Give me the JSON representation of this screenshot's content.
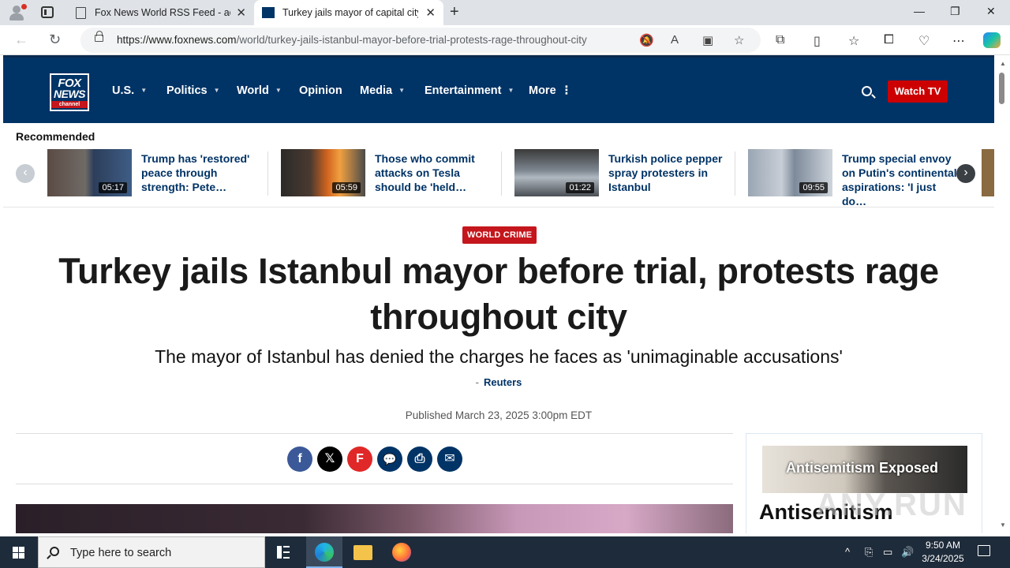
{
  "browser": {
    "tabs": [
      {
        "title": "Fox News World RSS Feed - aero",
        "active": false
      },
      {
        "title": "Turkey jails mayor of capital city",
        "active": true
      }
    ],
    "url_domain": "https://www.foxnews.com",
    "url_path": "/world/turkey-jails-istanbul-mayor-before-trial-protests-rage-throughout-city",
    "window_controls": [
      "—",
      "❐",
      "✕"
    ]
  },
  "site": {
    "logo": {
      "line1": "FOX",
      "line2": "NEWS",
      "line3": "channel"
    },
    "nav": [
      {
        "label": "U.S.",
        "caret": true
      },
      {
        "label": "Politics",
        "caret": true
      },
      {
        "label": "World",
        "caret": true
      },
      {
        "label": "Opinion",
        "caret": false
      },
      {
        "label": "Media",
        "caret": true
      },
      {
        "label": "Entertainment",
        "caret": true
      },
      {
        "label": "More",
        "caret": false
      }
    ],
    "watch_tv": "Watch TV",
    "colors": {
      "brand_navy": "#003366",
      "brand_red": "#cc0000"
    }
  },
  "recommended": {
    "title": "Recommended",
    "items": [
      {
        "text": "Trump has 'restored' peace through strength: Pete…",
        "duration": "05:17"
      },
      {
        "text": "Those who commit attacks on Tesla should be 'held…",
        "duration": "05:59"
      },
      {
        "text": "Turkish police pepper spray protesters in Istanbul",
        "duration": "01:22"
      },
      {
        "text": "Trump special envoy on Putin's continental aspirations: 'I just do…",
        "duration": "09:55"
      }
    ]
  },
  "article": {
    "eyebrow": "WORLD CRIME",
    "headline_line1": "Turkey jails Istanbul mayor before trial, protests rage",
    "headline_line2": "throughout city",
    "subhead": "The mayor of Istanbul has denied the charges he faces as 'unimaginable accusations'",
    "byline_sep": "-",
    "byline": "Reuters",
    "published": "Published March 23, 2025 3:00pm EDT"
  },
  "share": [
    {
      "name": "facebook-share-button",
      "glyph": "f",
      "color": "#3b5998"
    },
    {
      "name": "x-share-button",
      "glyph": "𝕏",
      "color": "#000000"
    },
    {
      "name": "flipboard-share-button",
      "glyph": "F",
      "color": "#e12828"
    },
    {
      "name": "comments-button",
      "glyph": "💬",
      "color": "#003366"
    },
    {
      "name": "print-button",
      "glyph": "⎙",
      "color": "#003366"
    },
    {
      "name": "email-share-button",
      "glyph": "✉",
      "color": "#003366"
    }
  ],
  "sidebar": {
    "promo_text": "Antisemitism Exposed",
    "title": "Antisemitism"
  },
  "watermark": "ANY.RUN",
  "taskbar": {
    "search_placeholder": "Type here to search",
    "time": "9:50 AM",
    "date": "3/24/2025"
  }
}
